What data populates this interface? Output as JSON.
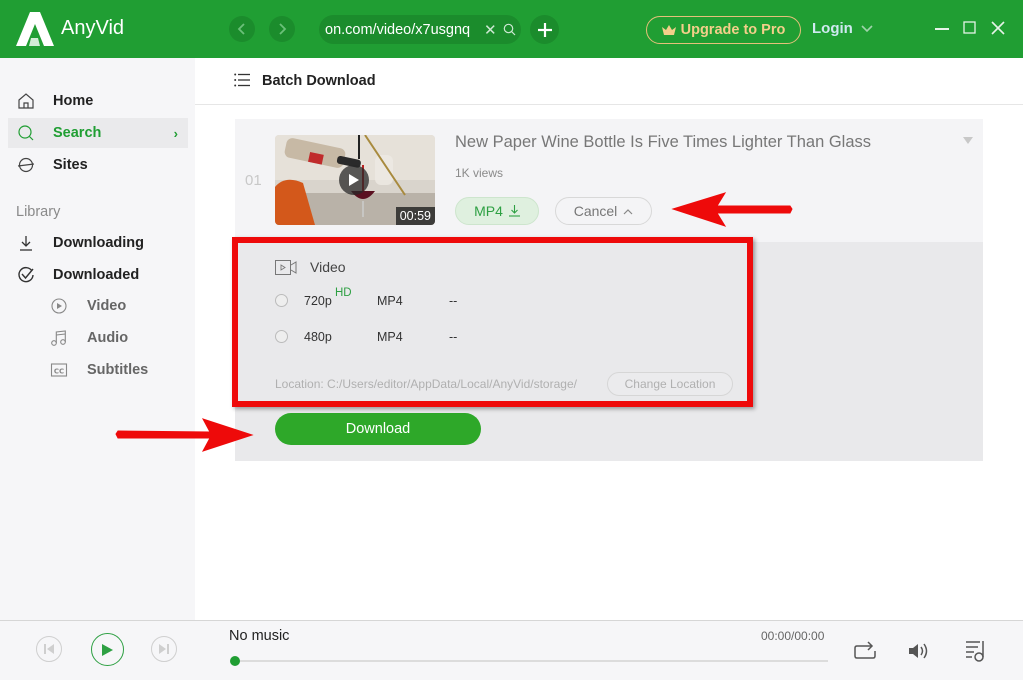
{
  "titlebar": {
    "app_name": "AnyVid",
    "url_value": "on.com/video/x7usgnq",
    "upgrade_label": "Upgrade to Pro",
    "login_label": "Login"
  },
  "sidebar": {
    "items": [
      {
        "label": "Home",
        "icon": "home-icon"
      },
      {
        "label": "Search",
        "icon": "search-icon",
        "active": true
      },
      {
        "label": "Sites",
        "icon": "globe-icon"
      }
    ],
    "library_heading": "Library",
    "library_items": [
      {
        "label": "Downloading",
        "icon": "download-icon"
      },
      {
        "label": "Downloaded",
        "icon": "check-circle-icon"
      }
    ],
    "downloaded_sub": [
      {
        "label": "Video",
        "icon": "play-circle-icon"
      },
      {
        "label": "Audio",
        "icon": "music-note-icon"
      },
      {
        "label": "Subtitles",
        "icon": "cc-icon"
      }
    ]
  },
  "main": {
    "batch_label": "Batch Download",
    "result": {
      "index": "01",
      "title": "New Paper Wine Bottle Is Five Times Lighter Than Glass",
      "views": "1K views",
      "duration": "00:59",
      "format_button": "MP4",
      "cancel_button": "Cancel",
      "section_label": "Video",
      "options": [
        {
          "resolution": "720p",
          "badge": "HD",
          "format": "MP4",
          "size": "--",
          "selected": false
        },
        {
          "resolution": "480p",
          "badge": "",
          "format": "MP4",
          "size": "--",
          "selected": false
        }
      ],
      "location": "Location: C:/Users/editor/AppData/Local/AnyVid/storage/",
      "change_location": "Change Location",
      "download_button": "Download"
    }
  },
  "player": {
    "track_title": "No music",
    "time": "00:00/00:00",
    "progress": 0
  },
  "colors": {
    "brand_green": "#209e33",
    "annotation_red": "#ee0a0a",
    "upgrade_gold": "#f3cf8a"
  }
}
